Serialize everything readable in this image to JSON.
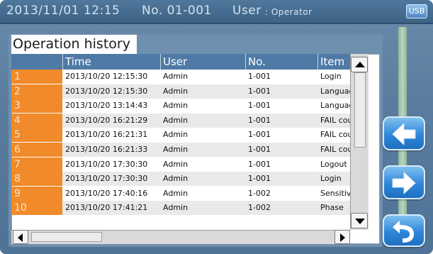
{
  "header": {
    "datetime": "2013/11/01  12:15",
    "number": "No. 01-001",
    "user_label": "User",
    "user_value": ": Operator",
    "usb_label": "USB"
  },
  "screen": {
    "title": "Operation history"
  },
  "table": {
    "columns": [
      "Time",
      "User",
      "No.",
      "Item"
    ],
    "rows": [
      {
        "index": "1",
        "time": "2013/10/20 12:15:30",
        "user": "Admin",
        "no": "1-001",
        "item": "Login"
      },
      {
        "index": "2",
        "time": "2013/10/20 12:15:30",
        "user": "Admin",
        "no": "1-001",
        "item": "Language"
      },
      {
        "index": "3",
        "time": "2013/10/20 13:14:43",
        "user": "Admin",
        "no": "1-001",
        "item": "Language"
      },
      {
        "index": "4",
        "time": "2013/10/20 16:21:29",
        "user": "Admin",
        "no": "1-001",
        "item": "FAIL cou"
      },
      {
        "index": "5",
        "time": "2013/10/20 16:21:31",
        "user": "Admin",
        "no": "1-001",
        "item": "FAIL cou"
      },
      {
        "index": "6",
        "time": "2013/10/20 16:21:33",
        "user": "Admin",
        "no": "1-001",
        "item": "FAIL cou"
      },
      {
        "index": "7",
        "time": "2013/10/20 17:30:30",
        "user": "Admin",
        "no": "1-001",
        "item": "Logout"
      },
      {
        "index": "8",
        "time": "2013/10/20 17:30:30",
        "user": "Admin",
        "no": "1-001",
        "item": "Login"
      },
      {
        "index": "9",
        "time": "2013/10/20 17:40:16",
        "user": "Admin",
        "no": "1-002",
        "item": "Sensitivit"
      },
      {
        "index": "10",
        "time": "2013/10/20 17:41:21",
        "user": "Admin",
        "no": "1-002",
        "item": "Phase"
      }
    ]
  },
  "nav": {
    "back_icon": "arrow-left-icon",
    "forward_icon": "arrow-right-icon",
    "return_icon": "return-icon"
  },
  "colors": {
    "header_bg": "#3d6386",
    "index_cell": "#f08a2a",
    "table_header": "#4f7aa6",
    "nav_button": "#2f86d8"
  }
}
